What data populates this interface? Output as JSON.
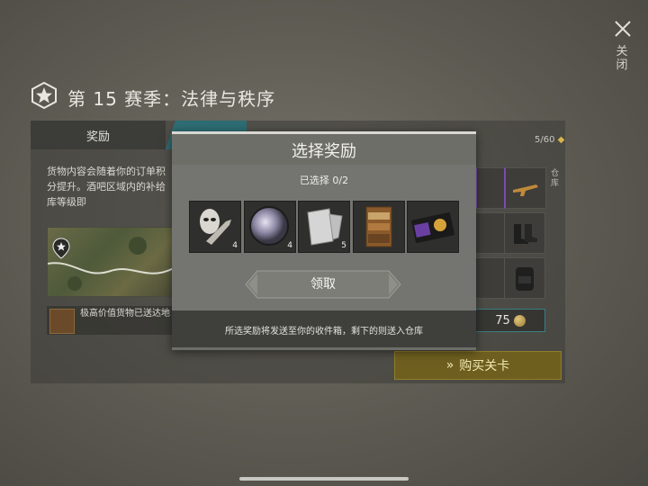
{
  "header": {
    "season_title": "第 15 赛季：法律与秩序",
    "close_label": "关闭",
    "season_badge_icon": "shield-star-icon",
    "close_icon": "close-x-icon"
  },
  "tabs": [
    {
      "label": "奖励"
    }
  ],
  "progress": {
    "text": "5/60"
  },
  "side_label": "仓库",
  "background": {
    "description": "货物内容会随着你的订单积分提升。酒吧区域内的补给库等级即",
    "note": "极高价值货物已送达地！",
    "coin_value": "75",
    "buy_button": "购买关卡",
    "buy_icon": "double-chevron-right-icon"
  },
  "modal": {
    "title": "选择奖励",
    "selected_count": "已选择 0/2",
    "rewards": [
      {
        "name": "mask-and-wrench",
        "icon": "mask-wrench-icon",
        "count": "4"
      },
      {
        "name": "lens",
        "icon": "lens-icon",
        "count": "4"
      },
      {
        "name": "foil-sheets",
        "icon": "foil-sheet-icon",
        "count": "5"
      },
      {
        "name": "supply-shelf",
        "icon": "shelf-icon",
        "count": ""
      },
      {
        "name": "badge-wallet",
        "icon": "badge-wallet-icon",
        "count": ""
      }
    ],
    "claim_button": "领取",
    "footer": "所选奖励将发送至你的收件箱，剩下的则送入仓库"
  },
  "colors": {
    "modal_bg": "#6e6e69",
    "teal_accent": "#2e6d74",
    "gold_button": "#6e5f1f",
    "purple_rarity": "#7a4bb0"
  }
}
